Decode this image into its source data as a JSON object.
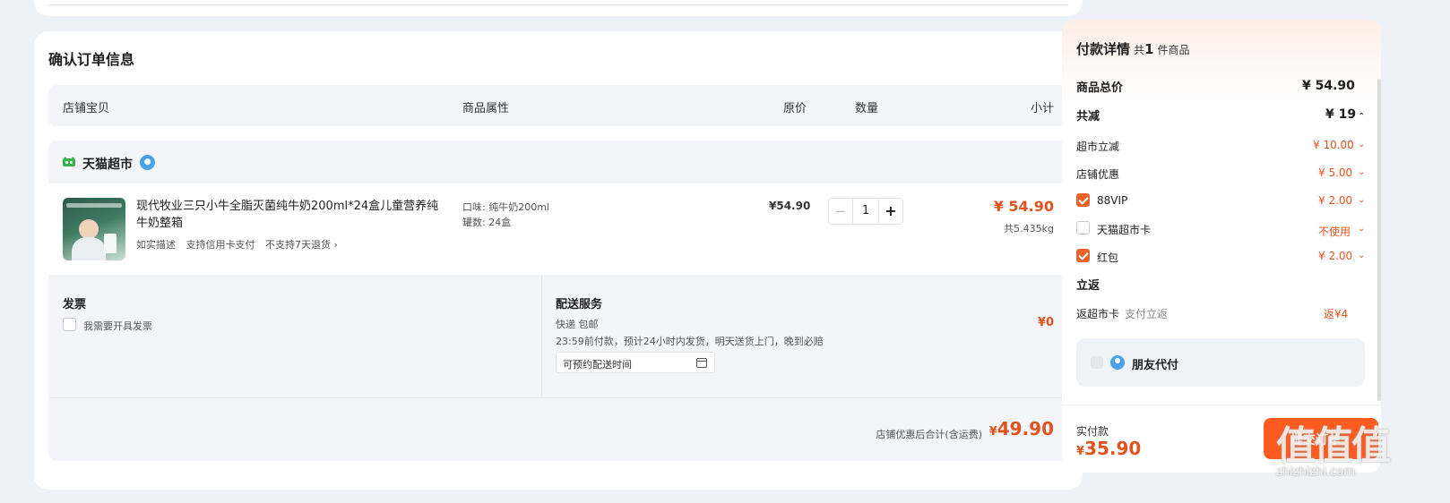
{
  "order": {
    "title": "确认订单信息",
    "headers": {
      "shop_item": "店铺宝贝",
      "attributes": "商品属性",
      "original_price": "原价",
      "quantity": "数量",
      "subtotal": "小计"
    },
    "shop": {
      "name": "天猫超市"
    },
    "item": {
      "title": "现代牧业三只小牛全脂灭菌纯牛奶200ml*24盒儿童营养纯牛奶整箱",
      "tags": [
        "如实描述",
        "支持信用卡支付",
        "不支持7天退货 ›"
      ],
      "attr_flavor": "口味: 纯牛奶200ml",
      "attr_count": "罐数: 24盒",
      "original_price": "¥54.90",
      "quantity": "1",
      "qty_minus": "−",
      "qty_plus": "+",
      "subtotal": "¥ 54.90",
      "weight": "共5.435kg"
    },
    "invoice": {
      "title": "发票",
      "checkbox_label": "我需要开具发票"
    },
    "delivery": {
      "title": "配送服务",
      "method": "快递 包邮",
      "note": "23:59前付款，预计24小时内发货，明天送货上门，晚到必赔",
      "input_value": "可预约配送时间",
      "price": "¥0"
    },
    "total": {
      "label": "店铺优惠后合计(含运费)",
      "yen": "¥",
      "amount": "49.90"
    }
  },
  "payment": {
    "title": "付款详情",
    "count_prefix": "共",
    "count": "1",
    "count_suffix": "件商品",
    "goods_total_label": "商品总价",
    "goods_total_value": "¥ 54.90",
    "discount_label": "共减",
    "discount_value": "¥ 19",
    "rows": [
      {
        "label": "超市立减",
        "value": "¥ 10.00",
        "checkbox": "none"
      },
      {
        "label": "店铺优惠",
        "value": "¥ 5.00",
        "checkbox": "none"
      },
      {
        "label": "88VIP",
        "value": "¥ 2.00",
        "checkbox": "checked"
      },
      {
        "label": "天猫超市卡",
        "value": "不使用",
        "checkbox": "unchecked"
      },
      {
        "label": "红包",
        "value": "¥ 2.00",
        "checkbox": "checked"
      }
    ],
    "rebate_title": "立返",
    "rebate_label": "返超市卡",
    "rebate_sub": "支付立返",
    "rebate_value": "返¥4",
    "friend_pay": "朋友代付",
    "actual_label": "实付款",
    "actual_yen": "¥",
    "actual_amount": "35.90",
    "submit_label": "提交订单"
  },
  "watermark": {
    "logo": "值值值",
    "url": "zhizhizhi.com"
  },
  "colors": {
    "accent": "#e0531f",
    "button": "#ff5a1f",
    "panel_bg": "#f3f5f8",
    "page_bg": "#eef1f5"
  }
}
